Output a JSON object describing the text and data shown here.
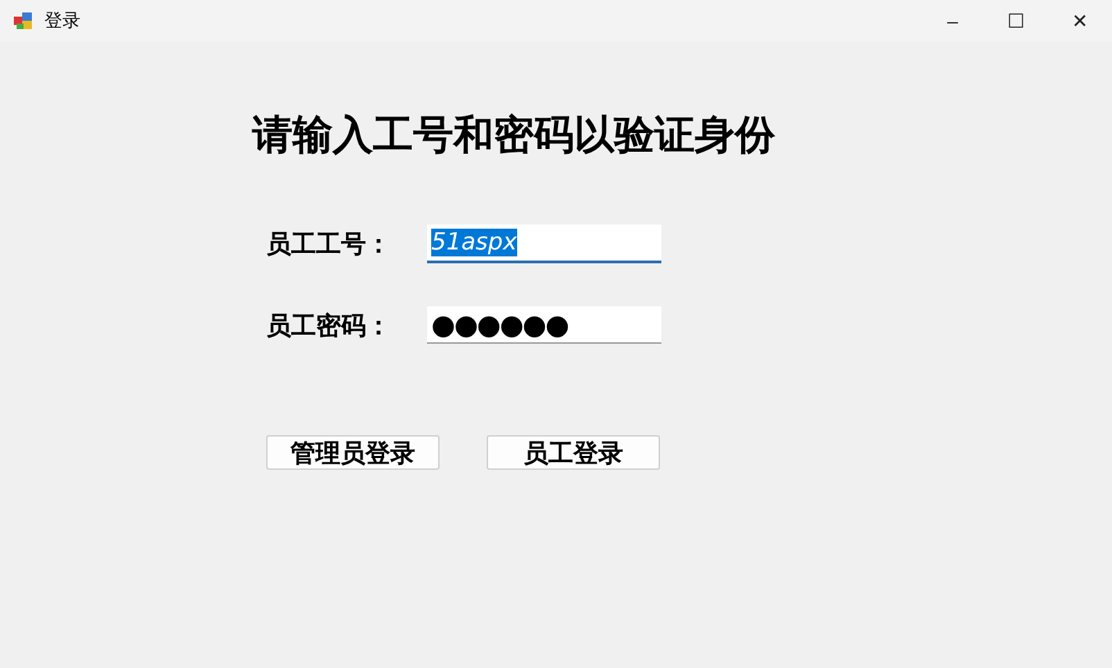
{
  "window": {
    "title": "登录",
    "controls": [
      "–",
      "☐",
      "✕"
    ]
  },
  "heading": "请输入工号和密码以验证身份",
  "fields": [
    {
      "label": "员工工号：",
      "value": "51aspx",
      "focused": true,
      "kind": "text"
    },
    {
      "label": "员工密码：",
      "value": "●●●●●●",
      "focused": false,
      "kind": "password"
    }
  ],
  "buttons": [
    "管理员登录",
    "员工登录"
  ]
}
